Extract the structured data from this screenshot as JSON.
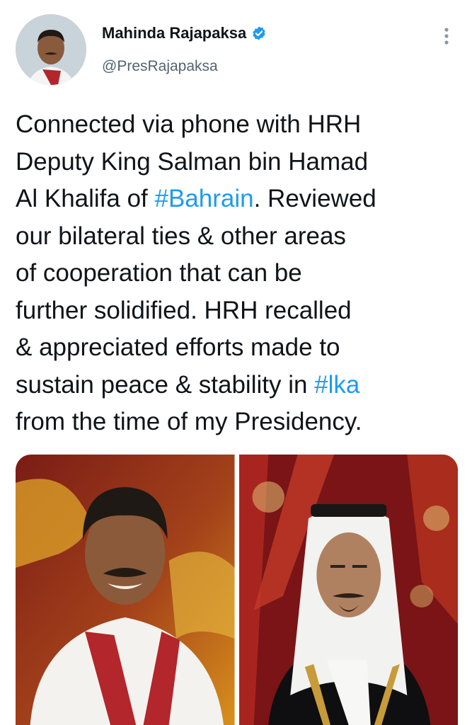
{
  "tweet": {
    "author_name": "Mahinda Rajapaksa",
    "handle": "@PresRajapaksa",
    "verified": true,
    "more_icon": "more-vertical-icon",
    "text_lines": [
      [
        {
          "t": "Connected via phone with HRH"
        }
      ],
      [
        {
          "t": "Deputy King Salman bin Hamad"
        }
      ],
      [
        {
          "t": "Al Khalifa of "
        },
        {
          "t": "#Bahrain",
          "tag": true
        },
        {
          "t": ". Reviewed"
        }
      ],
      [
        {
          "t": "our bilateral ties & other areas"
        }
      ],
      [
        {
          "t": "of cooperation that can be"
        }
      ],
      [
        {
          "t": "further solidified. HRH recalled"
        }
      ],
      [
        {
          "t": "& appreciated efforts made to"
        }
      ],
      [
        {
          "t": "sustain peace & stability in "
        },
        {
          "t": "#lka",
          "tag": true
        }
      ],
      [
        {
          "t": "from the time of my Presidency."
        }
      ]
    ],
    "hashtag_color": "#1d9bf0",
    "media": [
      {
        "name": "photo-left"
      },
      {
        "name": "photo-right"
      }
    ]
  }
}
